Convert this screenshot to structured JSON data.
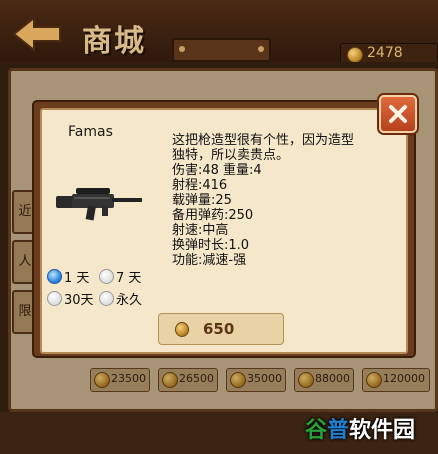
{
  "header": {
    "title": "商城",
    "coin_balance": "2478"
  },
  "background": {
    "side_tabs": [
      "近",
      "人",
      "限"
    ],
    "prices": [
      "23500",
      "26500",
      "35000",
      "88000",
      "120000"
    ]
  },
  "dialog": {
    "item_name": "Famas",
    "description_lines": [
      "这把枪造型很有个性，因为造型",
      "独特，所以卖贵点。",
      "伤害:48 重量:4",
      "射程:416",
      "载弹量:25",
      "备用弹药:250",
      "射速:中高",
      "换弹时长:1.0",
      "功能:减速-强"
    ],
    "duration_options": [
      {
        "label": "1 天",
        "selected": true
      },
      {
        "label": "7 天",
        "selected": false
      },
      {
        "label": "30天",
        "selected": false
      },
      {
        "label": "永久",
        "selected": false
      }
    ],
    "price": "650"
  },
  "watermark": {
    "part1": "谷",
    "part2": "普",
    "part3": "软件园"
  },
  "colors": {
    "accent": "#c5532a",
    "coin": "#e0a93a",
    "selected_radio": "#2f8ae0"
  },
  "icons": {
    "back": "left-arrow-icon",
    "coin": "gold-coin-icon",
    "close": "close-icon",
    "weapon": "famas-rifle-icon"
  }
}
